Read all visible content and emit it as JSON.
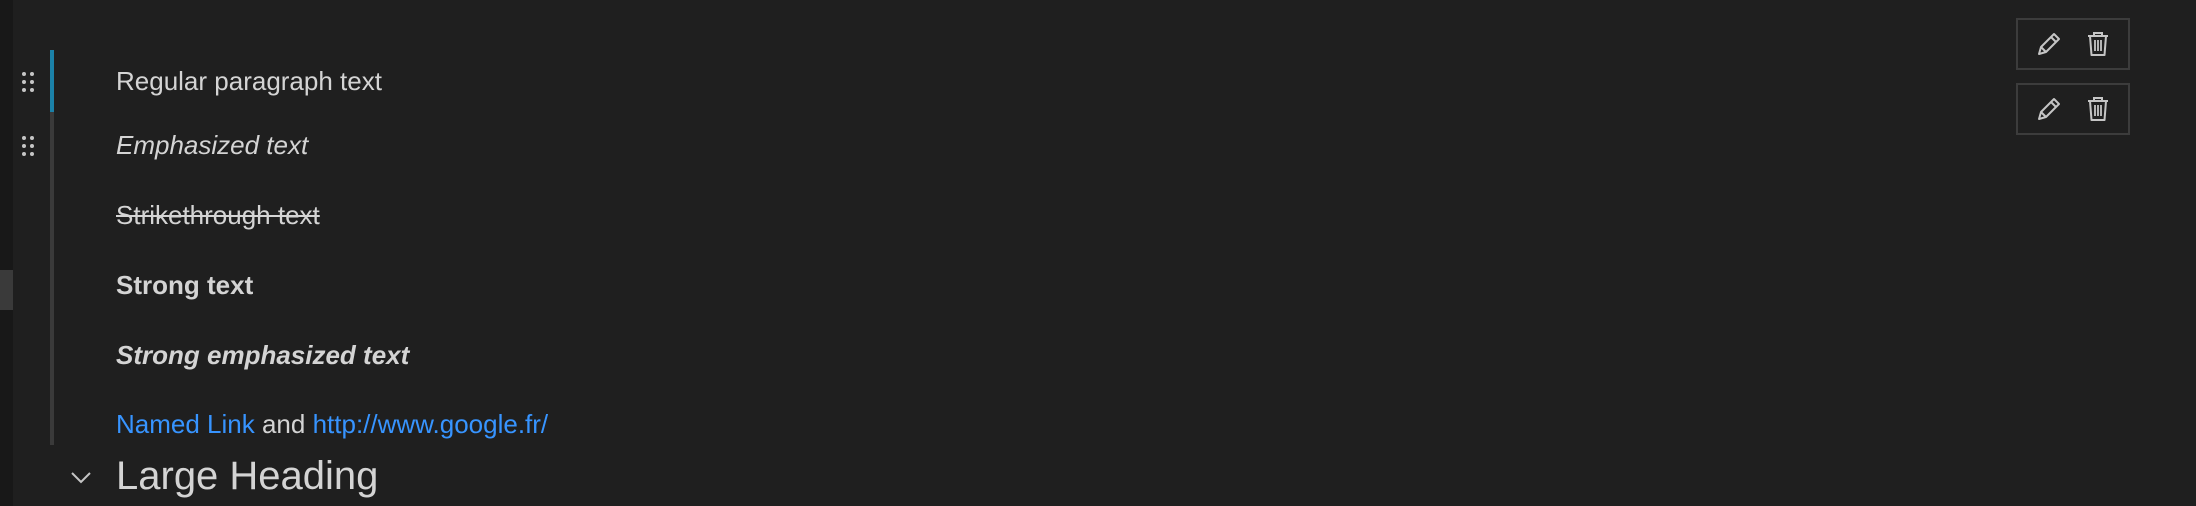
{
  "cell": {
    "lines": {
      "regular": "Regular paragraph text",
      "emphasized": "Emphasized text",
      "strikethrough": "Strikethrough text",
      "strong": "Strong text",
      "strong_emphasized": "Strong emphasized text"
    },
    "links": {
      "named_link": "Named Link",
      "joiner": "and",
      "url_link": "http://www.google.fr/"
    }
  },
  "heading": {
    "text": "Large Heading",
    "collapse_icon": "chevron-down-icon"
  },
  "toolbars": [
    {
      "edit_icon": "pencil-icon",
      "delete_icon": "trash-icon"
    },
    {
      "edit_icon": "pencil-icon",
      "delete_icon": "trash-icon"
    }
  ],
  "colors": {
    "background": "#1f1f1f",
    "text": "#d4d4d4",
    "link": "#3794ff",
    "focus_bar": "#1b81a8"
  }
}
